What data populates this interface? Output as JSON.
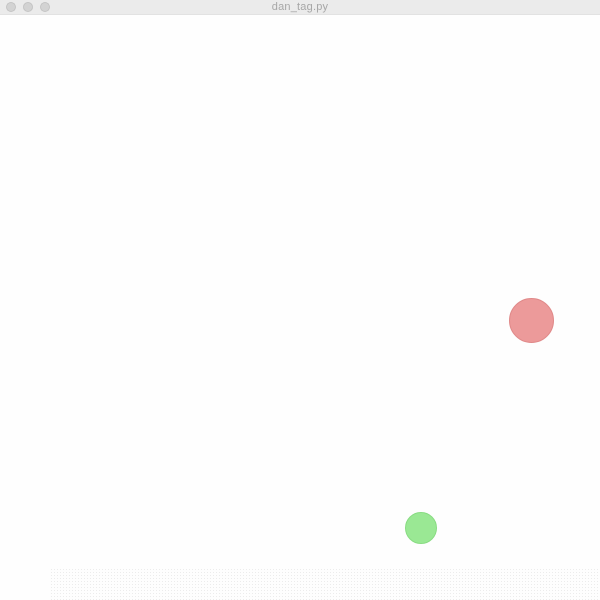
{
  "window": {
    "title": "dan_tag.py"
  },
  "colors": {
    "titlebar": "#f0f0f0",
    "title_text": "#a6a6a6",
    "canvas_background": "#fefefe",
    "red_ball": "#ec9a9a",
    "green_ball": "#9ae894"
  },
  "icons": {
    "close": "close-icon",
    "minimize": "minimize-icon",
    "zoom": "zoom-icon"
  }
}
